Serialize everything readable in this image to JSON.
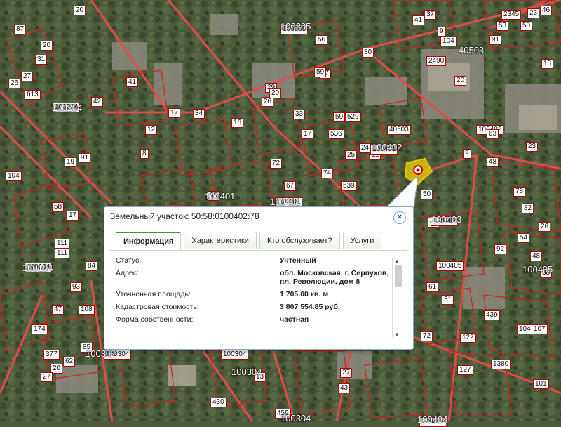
{
  "map": {
    "parcel_labels": [
      "74",
      "81",
      "14",
      "26",
      "27",
      "613",
      "20",
      "42",
      "100204",
      "41",
      "12",
      "104",
      "8",
      "19",
      "91",
      "58",
      "17",
      "111",
      "111",
      "100104",
      "84",
      "93",
      "47",
      "108",
      "174",
      "85",
      "377",
      "62",
      "20",
      "27",
      "100205",
      "56",
      "57",
      "59",
      "29",
      "26",
      "20",
      "17",
      "34",
      "16",
      "33",
      "17",
      "59",
      "536",
      "529",
      "25",
      "24",
      "11",
      "74",
      "539",
      "72",
      "67",
      "69",
      "100401",
      "100401",
      "100402",
      "23",
      "9",
      "48",
      "60",
      "78",
      "50",
      "100403",
      "82",
      "54",
      "26",
      "48",
      "92",
      "38",
      "100405",
      "61",
      "31",
      "439",
      "104",
      "107",
      "122",
      "127",
      "101",
      "1380",
      "27",
      "43",
      "459",
      "430",
      "100304",
      "100304",
      "100302",
      "13",
      "100404",
      "72",
      "30",
      "50",
      "104",
      "37",
      "20",
      "40503",
      "2345",
      "53",
      "91",
      "63",
      "2490",
      "23",
      "46",
      "41",
      "9",
      "13",
      "87",
      "20",
      "31"
    ],
    "quarter_labels": [
      "100204",
      "100205",
      "100104",
      "100401",
      "100401",
      "100402",
      "100403",
      "100405",
      "100302",
      "100304",
      "100304",
      "40503",
      "100404"
    ],
    "parcel_color": "#c00000",
    "road_color": "#e06060"
  },
  "popup": {
    "title": "Земельный участок: 50:58:0100402:78",
    "close_icon": "close-icon",
    "tabs": [
      {
        "label": "Информация",
        "active": true
      },
      {
        "label": "Характеристики",
        "active": false
      },
      {
        "label": "Кто обслуживает?",
        "active": false
      },
      {
        "label": "Услуги",
        "active": false
      }
    ],
    "rows": [
      {
        "key": "Статус:",
        "value": "Учтенный"
      },
      {
        "key": "Адрес:",
        "value": "обл. Московская, г. Серпухов, пл. Революции, дом 8"
      },
      {
        "key": "Уточненная площадь:",
        "value": "1 705.00 кв. м"
      },
      {
        "key": "Кадастровая стоимость:",
        "value": "3 807 554.85 руб."
      },
      {
        "key": "Форма собственности:",
        "value": "частная"
      }
    ]
  },
  "marker": {
    "icon": "location-pin-icon",
    "highlight_color": "#f0d000"
  }
}
